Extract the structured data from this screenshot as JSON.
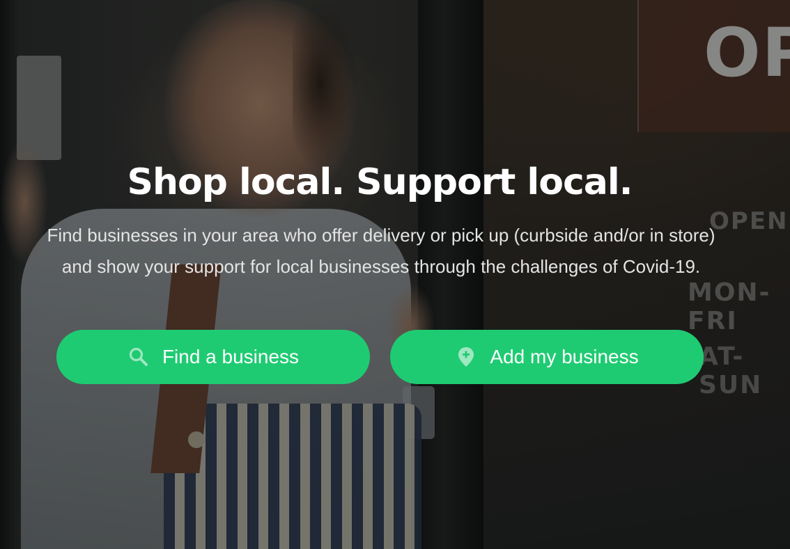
{
  "hero": {
    "headline": "Shop local. Support local.",
    "subtext_line1": "Find businesses in your area who offer delivery or pick up (curbside and/or in store)",
    "subtext_line2": "and show your support for local businesses through the challenges of Covid-19."
  },
  "background_sign": {
    "top_text": "OP",
    "opening": "OPENIN",
    "mon_fri": "MON-FRI",
    "sat_sun": "AT-SUN"
  },
  "actions": [
    {
      "label": "Find a business",
      "icon": "search-icon"
    },
    {
      "label": "Add my business",
      "icon": "add-location-icon"
    }
  ],
  "colors": {
    "accent": "#1fcb72",
    "icon_tint": "#9ee8c0",
    "headline": "#ffffff",
    "overlay": "#0a0e0e"
  }
}
